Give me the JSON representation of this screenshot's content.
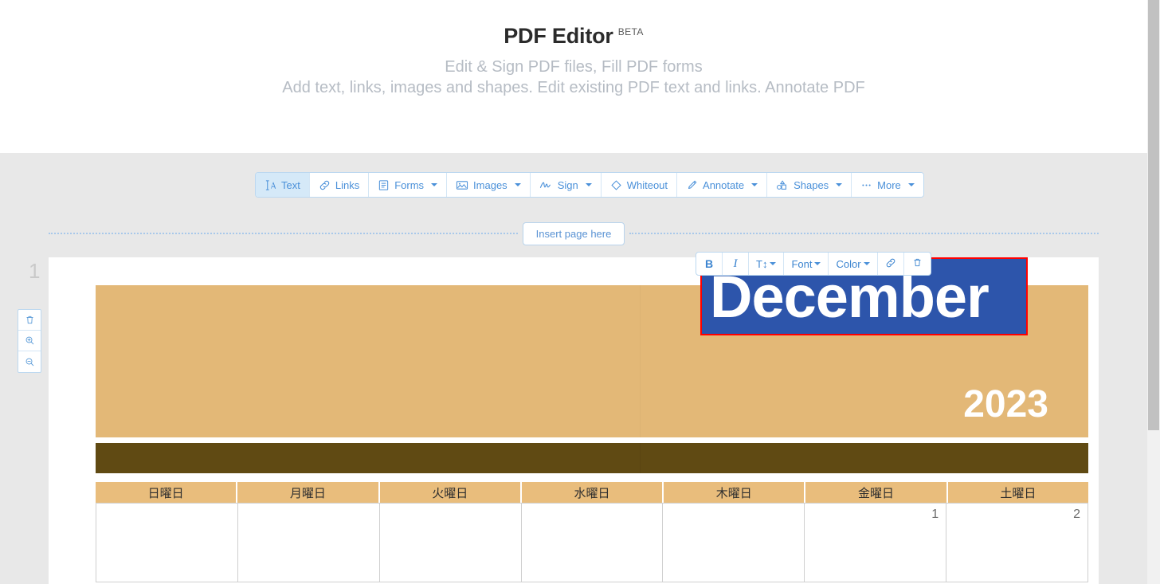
{
  "header": {
    "title": "PDF Editor",
    "badge": "BETA",
    "subtitle_line1": "Edit & Sign PDF files, Fill PDF forms",
    "subtitle_line2": "Add text, links, images and shapes. Edit existing PDF text and links. Annotate PDF"
  },
  "toolbar": {
    "items": [
      {
        "label": "Text",
        "icon": "text-cursor-icon",
        "active": true,
        "dropdown": false
      },
      {
        "label": "Links",
        "icon": "link-icon",
        "active": false,
        "dropdown": false
      },
      {
        "label": "Forms",
        "icon": "form-icon",
        "active": false,
        "dropdown": true
      },
      {
        "label": "Images",
        "icon": "image-icon",
        "active": false,
        "dropdown": true
      },
      {
        "label": "Sign",
        "icon": "signature-icon",
        "active": false,
        "dropdown": true
      },
      {
        "label": "Whiteout",
        "icon": "eraser-icon",
        "active": false,
        "dropdown": false
      },
      {
        "label": "Annotate",
        "icon": "highlighter-icon",
        "active": false,
        "dropdown": true
      },
      {
        "label": "Shapes",
        "icon": "shapes-icon",
        "active": false,
        "dropdown": true
      },
      {
        "label": "More",
        "icon": "ellipsis-icon",
        "active": false,
        "dropdown": true
      }
    ]
  },
  "insert_page": {
    "label": "Insert page here"
  },
  "page_panel": {
    "page_number": "1",
    "tools": [
      {
        "name": "delete-page-button",
        "icon": "trash-icon"
      },
      {
        "name": "zoom-in-button",
        "icon": "zoom-in-icon"
      },
      {
        "name": "zoom-out-button",
        "icon": "zoom-out-icon"
      }
    ]
  },
  "format_toolbar": {
    "bold_label": "B",
    "italic_label": "I",
    "font_size_label": "T↕",
    "font_label": "Font",
    "color_label": "Color",
    "link_icon": "link-icon",
    "delete_icon": "trash-icon"
  },
  "document": {
    "selected_text": "December",
    "year": "2023",
    "colors": {
      "header_gold": "#e3b877",
      "band_brown": "#604a13",
      "weekday_gold": "#e9bd7c",
      "selection_blue": "#2d55ab",
      "selection_outline": "#ff0000"
    },
    "weekdays": [
      "日曜日",
      "月曜日",
      "火曜日",
      "水曜日",
      "木曜日",
      "金曜日",
      "土曜日"
    ],
    "first_week": [
      "",
      "",
      "",
      "",
      "",
      "1",
      "2"
    ]
  }
}
